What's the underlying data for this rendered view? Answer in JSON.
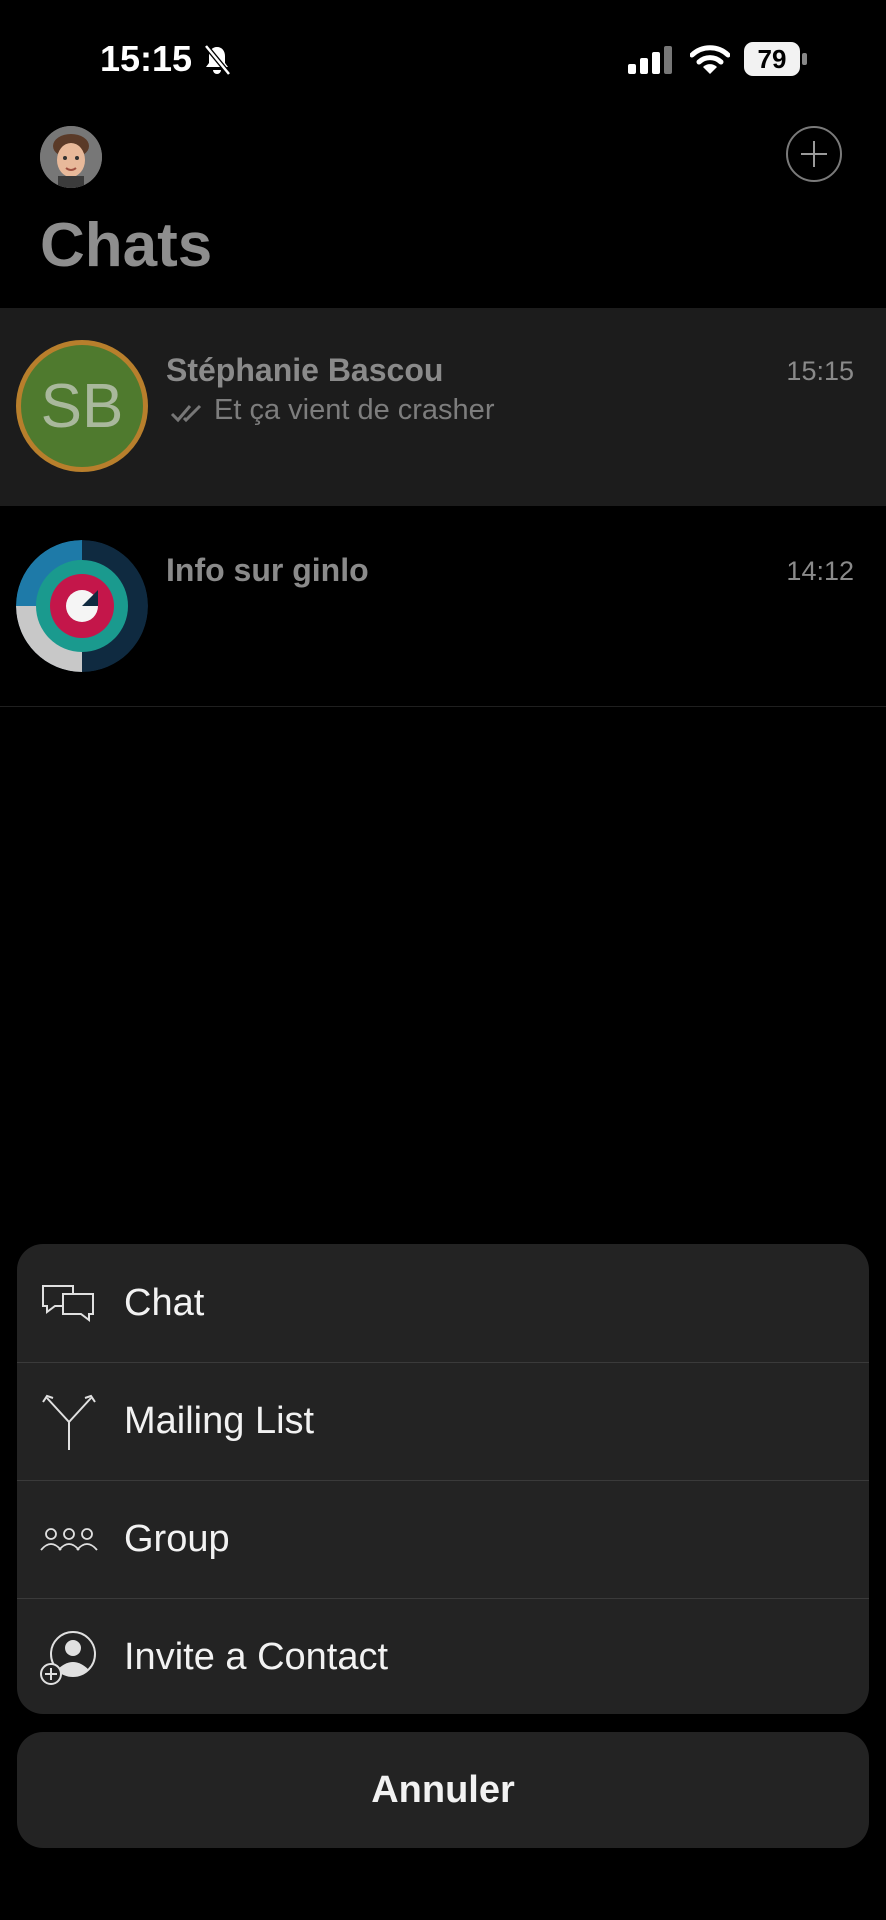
{
  "status_bar": {
    "time": "15:15",
    "battery": "79",
    "icons": [
      "bell-slash-icon",
      "signal-icon",
      "wifi-icon",
      "battery-icon"
    ]
  },
  "header": {
    "title": "Chats",
    "profile_icon": "avatar",
    "action_icon": "plus-circle-icon"
  },
  "chats": [
    {
      "name": "Stéphanie Bascou",
      "initials": "SB",
      "time": "15:15",
      "preview": "Et ça vient de crasher",
      "status_icon": "double-check-icon"
    },
    {
      "name": "Info sur ginlo",
      "time": "14:12",
      "preview": ""
    }
  ],
  "action_sheet": {
    "items": [
      {
        "label": "Chat",
        "icon": "chat-bubbles-icon"
      },
      {
        "label": "Mailing List",
        "icon": "split-arrows-icon"
      },
      {
        "label": "Group",
        "icon": "group-icon"
      },
      {
        "label": "Invite a Contact",
        "icon": "invite-contact-icon"
      }
    ],
    "cancel_label": "Annuler"
  },
  "colors": {
    "background": "#000000",
    "sheet": "#232323",
    "selected_row": "#1c1c1c",
    "sb_avatar_fill": "#4f7a2e",
    "sb_avatar_ring": "#b87f2c"
  }
}
